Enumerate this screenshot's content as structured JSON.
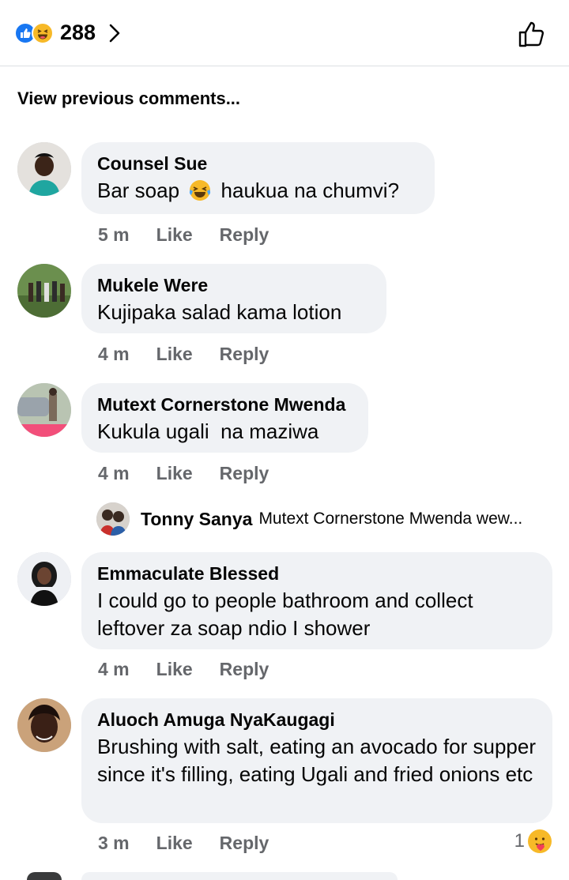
{
  "reactions": {
    "icons": [
      "like-icon",
      "haha-icon"
    ],
    "count": "288"
  },
  "view_previous": "View previous comments...",
  "comments": [
    {
      "author": "Counsel Sue",
      "text_before": "Bar soap",
      "emoji": "laughing-tears-emoji",
      "text_after": "haukua na chumvi?",
      "time": "5 m",
      "like": "Like",
      "reply": "Reply"
    },
    {
      "author": "Mukele Were",
      "text": "Kujipaka salad kama lotion",
      "time": "4 m",
      "like": "Like",
      "reply": "Reply"
    },
    {
      "author": "Mutext Cornerstone Mwenda",
      "text": "Kukula ugali  na maziwa",
      "time": "4 m",
      "like": "Like",
      "reply": "Reply",
      "reply_preview": {
        "author": "Tonny Sanya",
        "text": "Mutext Cornerstone Mwenda wew..."
      }
    },
    {
      "author": "Emmaculate Blessed",
      "text": "I could go to people bathroom and collect leftover za soap ndio I shower",
      "time": "4 m",
      "like": "Like",
      "reply": "Reply"
    },
    {
      "author": "Aluoch Amuga NyaKaugagi",
      "text": "Brushing with salt, eating an avocado for supper since it's filling, eating Ugali and fried onions etc",
      "time": "3 m",
      "like": "Like",
      "reply": "Reply",
      "reaction_count": "1",
      "reaction_icon": "care-icon"
    }
  ],
  "colors": {
    "like_blue": "#1877f2",
    "bubble_bg": "#f0f2f5",
    "meta_gray": "#65676b"
  }
}
